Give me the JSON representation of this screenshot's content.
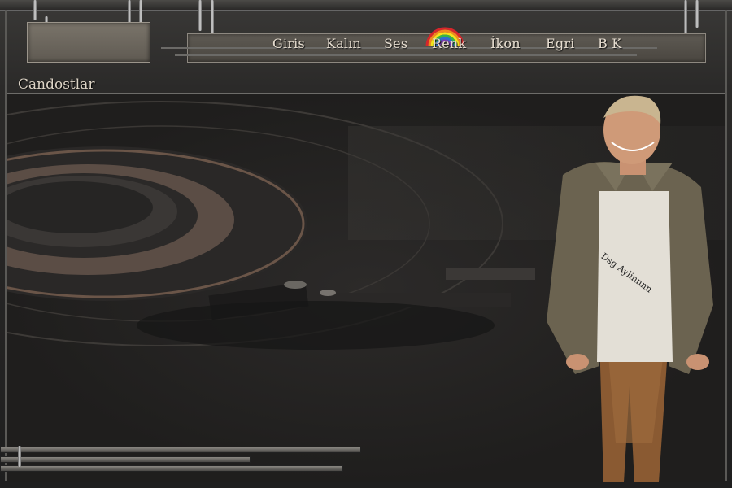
{
  "site": {
    "title": "Candostlar"
  },
  "nav": {
    "items": [
      {
        "label": "Giris"
      },
      {
        "label": "Kalın"
      },
      {
        "label": "Ses"
      },
      {
        "label": "Renk"
      },
      {
        "label": "İkon"
      },
      {
        "label": "Egri"
      },
      {
        "label": "B K"
      }
    ]
  },
  "watermark": {
    "text": "Dsg Aylinnnn"
  },
  "colors": {
    "nav_text": "#e6ddd0",
    "frame": "#6b6a67",
    "background": "#1f1f1f"
  },
  "images": {
    "background": "vinyl-turntable-photo",
    "figure": "smiling-man-in-cardigan",
    "rainbow": "rainbow-icon"
  }
}
